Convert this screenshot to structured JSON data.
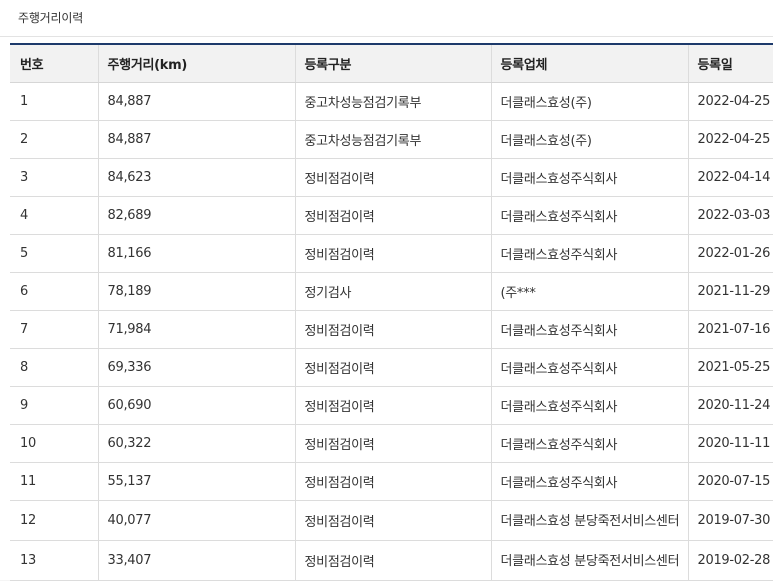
{
  "panel": {
    "title": "주행거리이력"
  },
  "table": {
    "headers": [
      "번호",
      "주행거리(km)",
      "등록구분",
      "등록업체",
      "등록일"
    ],
    "rows": [
      [
        "1",
        "84,887",
        "중고차성능점검기록부",
        "더클래스효성(주)",
        "2022-04-25"
      ],
      [
        "2",
        "84,887",
        "중고차성능점검기록부",
        "더클래스효성(주)",
        "2022-04-25"
      ],
      [
        "3",
        "84,623",
        "정비점검이력",
        "더클래스효성주식회사",
        "2022-04-14"
      ],
      [
        "4",
        "82,689",
        "정비점검이력",
        "더클래스효성주식회사",
        "2022-03-03"
      ],
      [
        "5",
        "81,166",
        "정비점검이력",
        "더클래스효성주식회사",
        "2022-01-26"
      ],
      [
        "6",
        "78,189",
        "정기검사",
        "(주***",
        "2021-11-29"
      ],
      [
        "7",
        "71,984",
        "정비점검이력",
        "더클래스효성주식회사",
        "2021-07-16"
      ],
      [
        "8",
        "69,336",
        "정비점검이력",
        "더클래스효성주식회사",
        "2021-05-25"
      ],
      [
        "9",
        "60,690",
        "정비점검이력",
        "더클래스효성주식회사",
        "2020-11-24"
      ],
      [
        "10",
        "60,322",
        "정비점검이력",
        "더클래스효성주식회사",
        "2020-11-11"
      ],
      [
        "11",
        "55,137",
        "정비점검이력",
        "더클래스효성주식회사",
        "2020-07-15"
      ],
      [
        "12",
        "40,077",
        "정비점검이력",
        "더클래스효성 분당죽전서비스센터",
        "2019-07-30"
      ],
      [
        "13",
        "33,407",
        "정비점검이력",
        "더클래스효성 분당죽전서비스센터",
        "2019-02-28"
      ]
    ]
  }
}
